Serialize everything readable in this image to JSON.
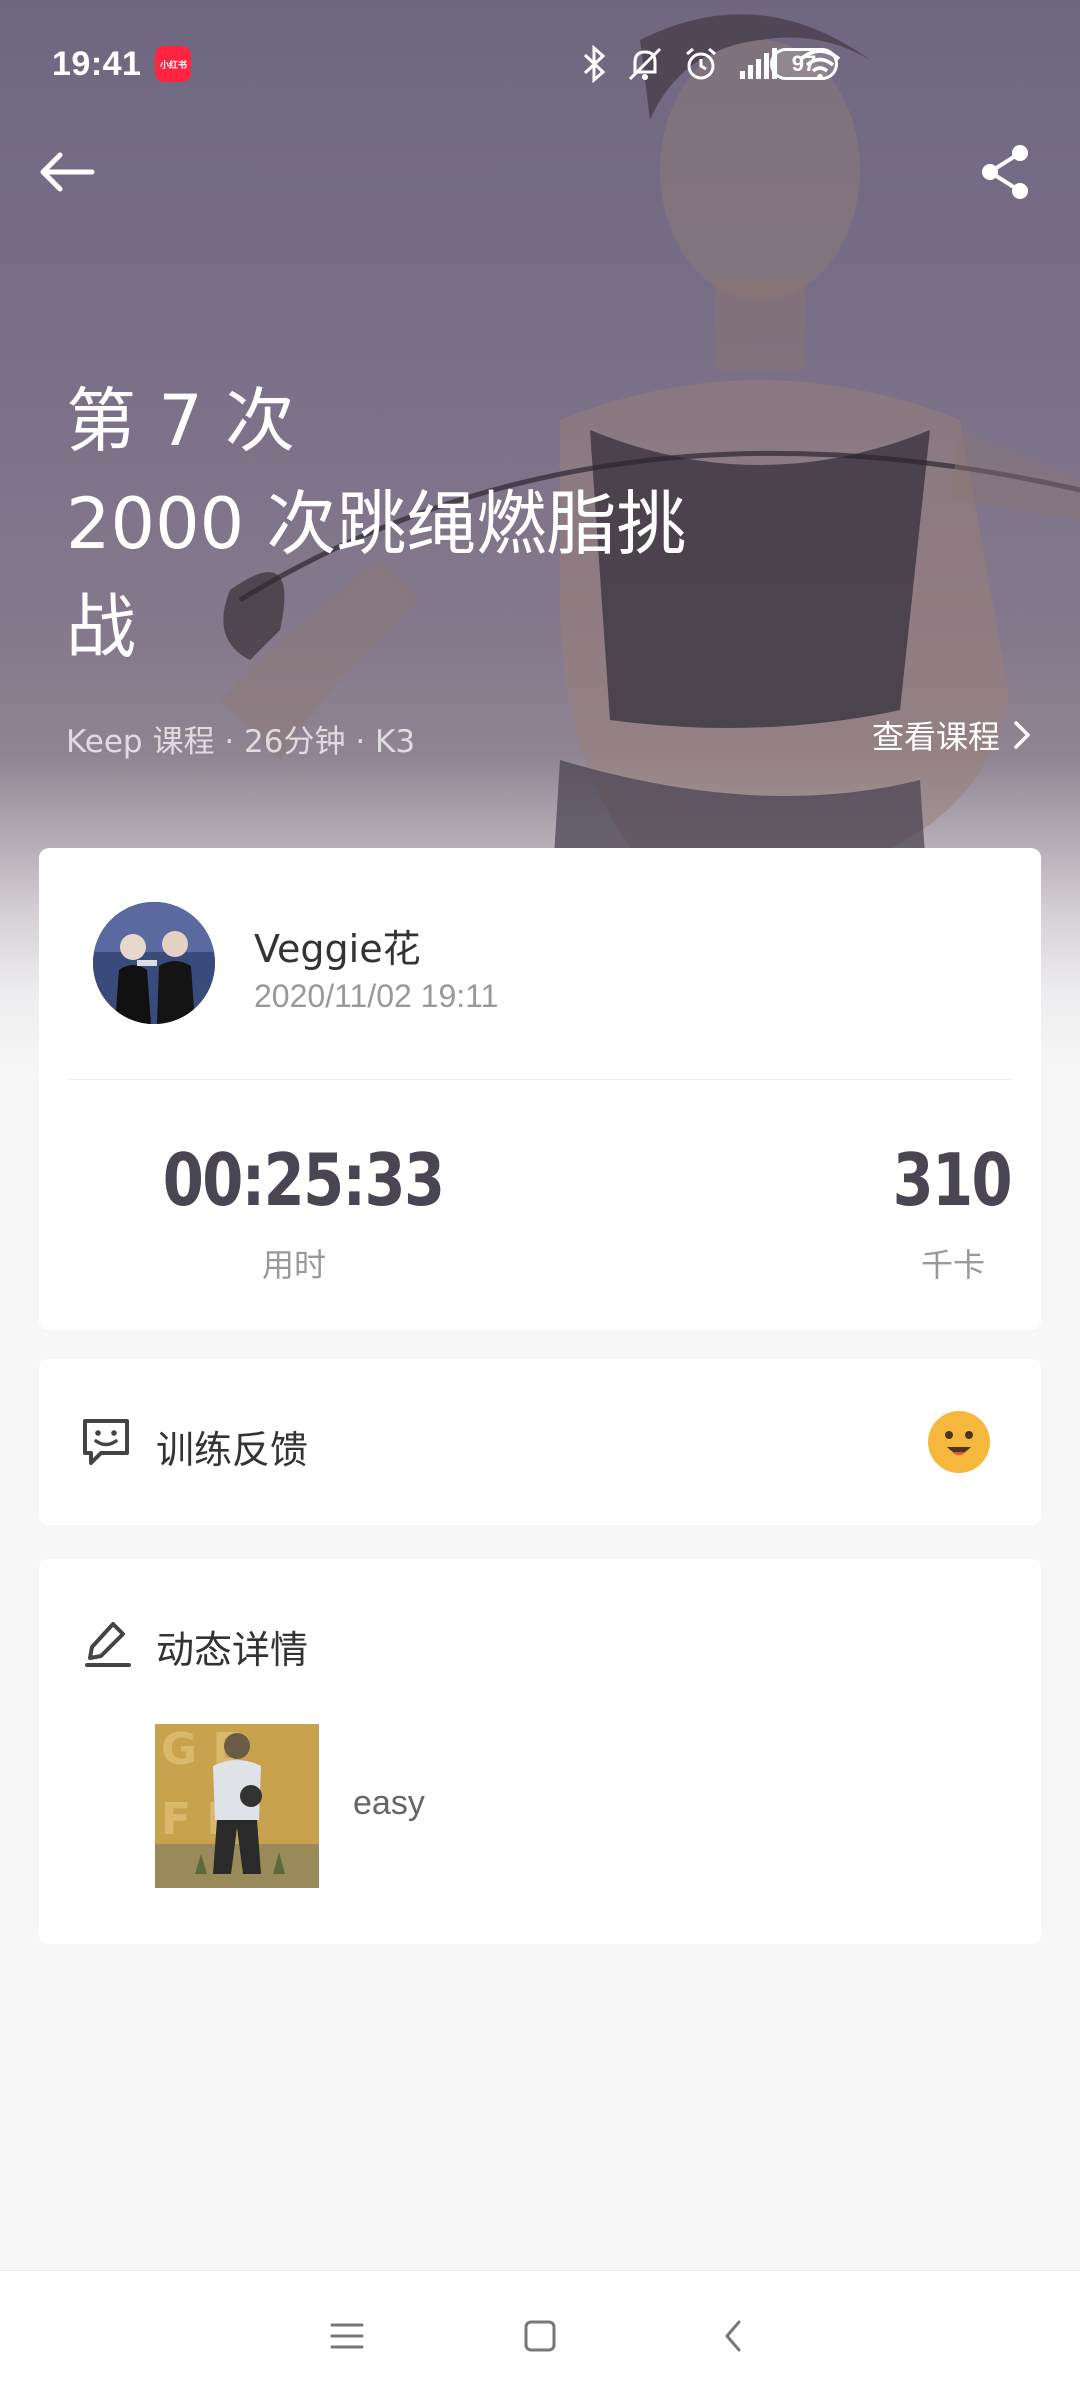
{
  "status_bar": {
    "time": "19:41",
    "app_badge": "小红书",
    "battery": "97"
  },
  "hero": {
    "title_line1": "第 7 次",
    "title_line2": "2000 次跳绳燃脂挑",
    "title_line3": "战",
    "meta": "Keep 课程 · 26分钟 · K3",
    "view_course": "查看课程"
  },
  "user": {
    "name": "Veggie花",
    "datetime": "2020/11/02 19:11"
  },
  "stats": {
    "duration": "00:25:33",
    "duration_label": "用时",
    "calories": "310",
    "calories_label": "千卡"
  },
  "feedback": {
    "label": "训练反馈",
    "icon": "feedback-icon",
    "emoji": "smiling-face-icon"
  },
  "detail": {
    "label": "动态详情",
    "text": "easy",
    "icon": "pen-icon"
  },
  "colors": {
    "hero": "#7a7088",
    "stat": "#4a4553",
    "emoji": "#f5b83d",
    "background": "#f7f7f8"
  }
}
